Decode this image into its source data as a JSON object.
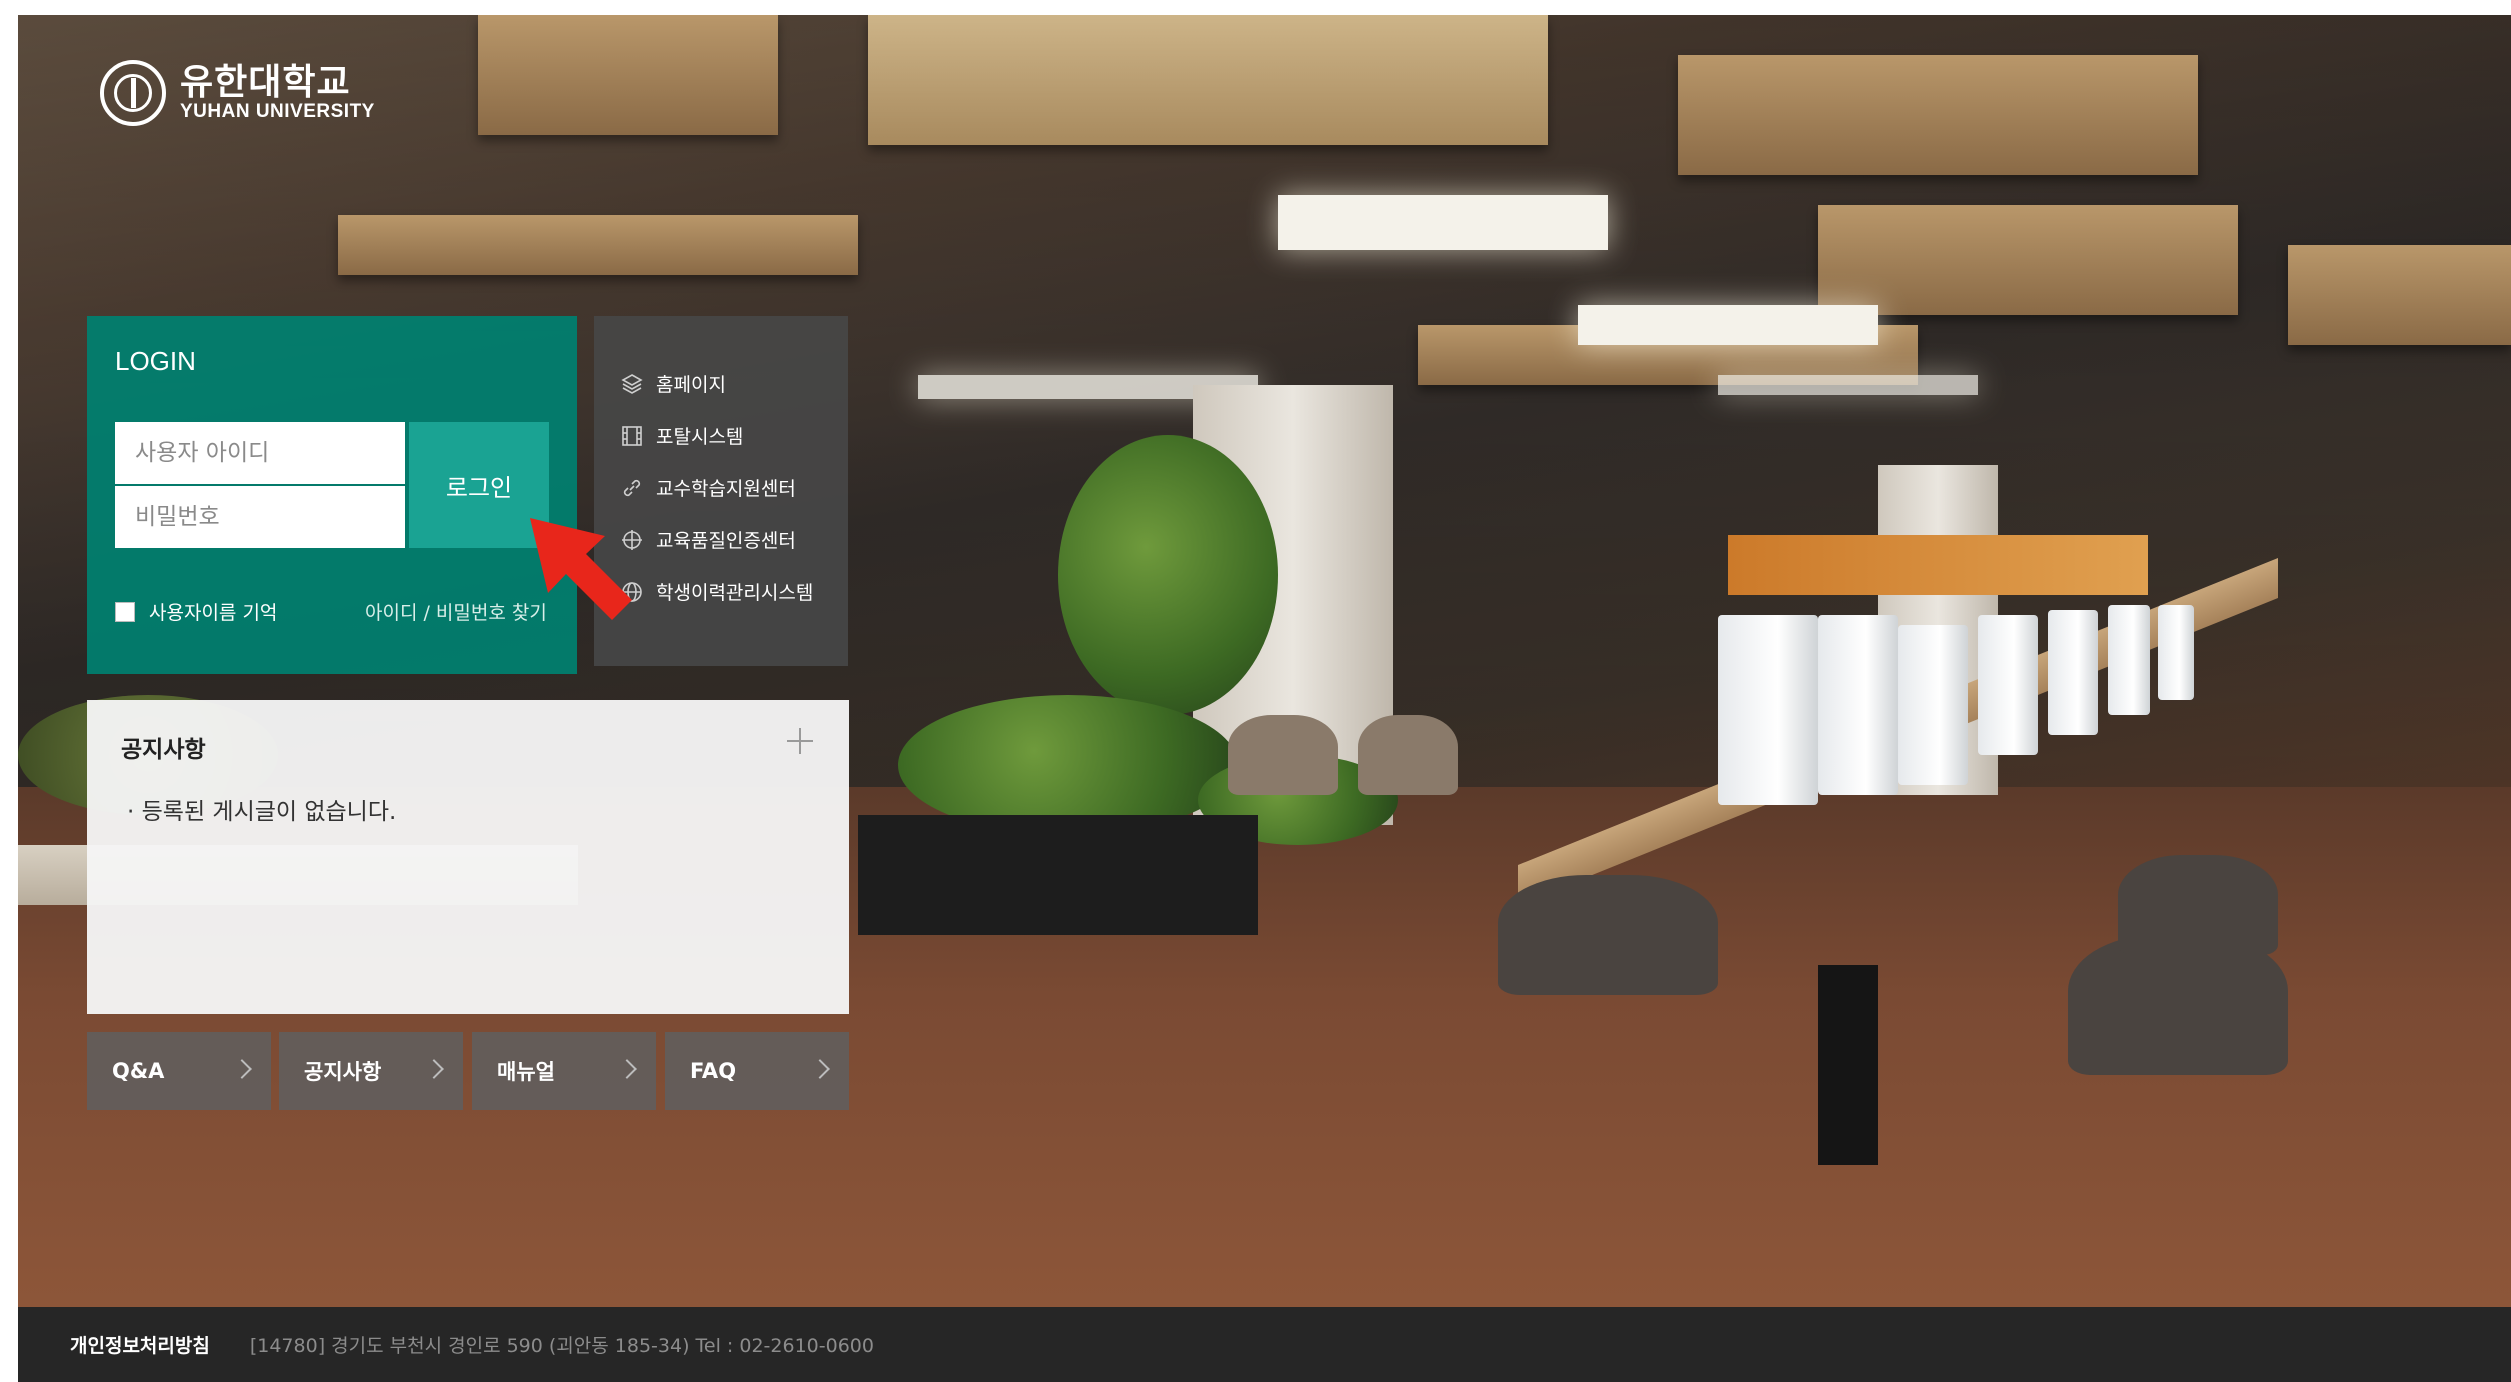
{
  "logo": {
    "name_kr": "유한대학교",
    "name_en": "YUHAN UNIVERSITY"
  },
  "login": {
    "title": "LOGIN",
    "user_placeholder": "사용자 아이디",
    "password_placeholder": "비밀번호",
    "button_label": "로그인",
    "remember_label": "사용자이름 기억",
    "find_label": "아이디 / 비밀번호 찾기"
  },
  "quick_links": [
    {
      "label": "홈페이지",
      "icon": "layers-icon"
    },
    {
      "label": "포탈시스템",
      "icon": "film-icon"
    },
    {
      "label": "교수학습지원센터",
      "icon": "link-icon"
    },
    {
      "label": "교육품질인증센터",
      "icon": "crosshair-icon"
    },
    {
      "label": "학생이력관리시스템",
      "icon": "globe-icon"
    }
  ],
  "notice": {
    "title": "공지사항",
    "empty_message": "· 등록된 게시글이 없습니다."
  },
  "bottom_buttons": [
    {
      "label": "Q&A"
    },
    {
      "label": "공지사항"
    },
    {
      "label": "매뉴얼"
    },
    {
      "label": "FAQ"
    }
  ],
  "footer": {
    "privacy": "개인정보처리방침",
    "address": "[14780] 경기도 부천시 경인로 590 (괴안동 185-34)   Tel : 02-2610-0600"
  },
  "colors": {
    "login_panel": "#008070",
    "login_button": "#1aa393",
    "quick_panel": "#464646",
    "footer": "#262626",
    "arrow": "#e8261b"
  }
}
